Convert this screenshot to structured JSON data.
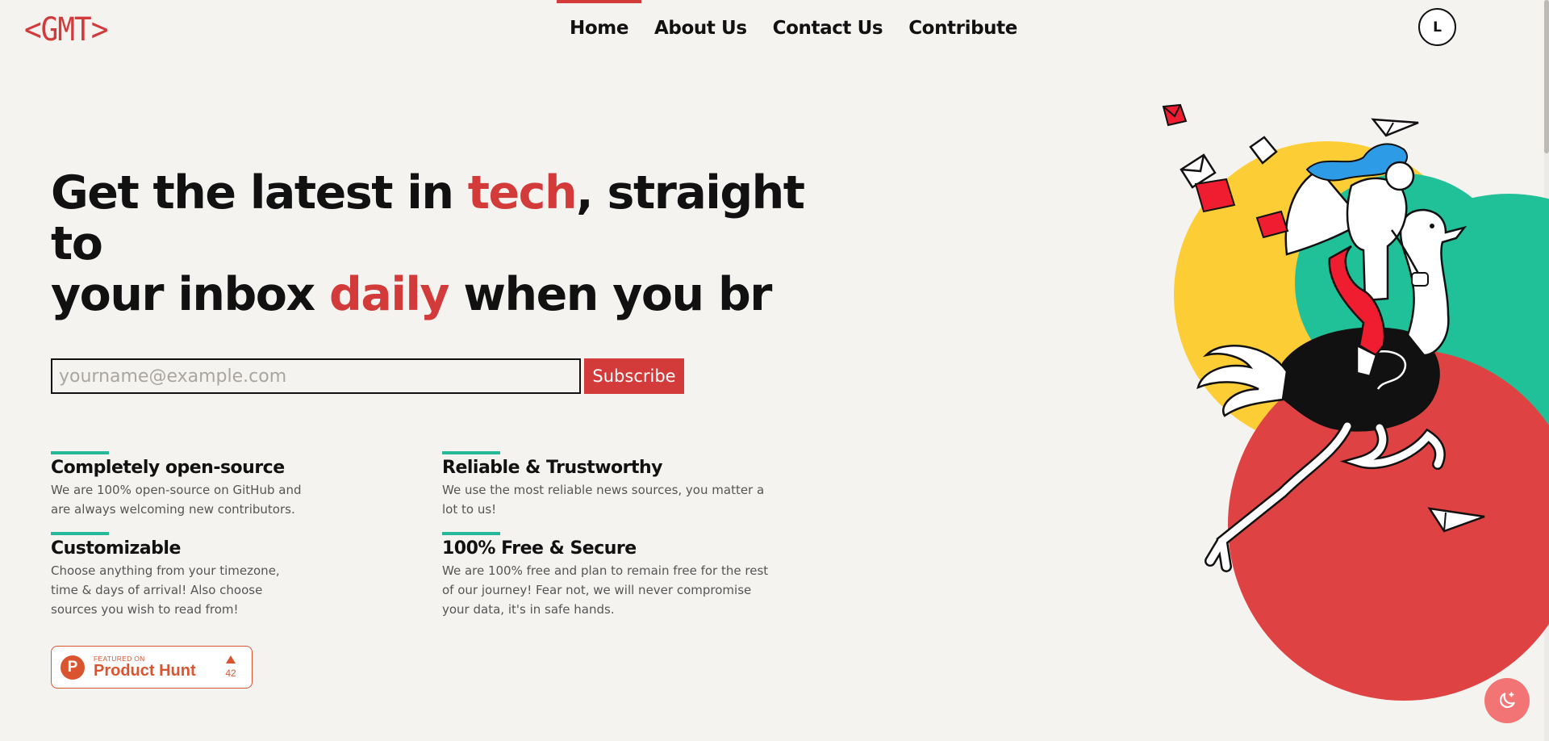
{
  "header": {
    "logo": "<GMT>",
    "nav": [
      {
        "label": "Home",
        "active": true
      },
      {
        "label": "About Us",
        "active": false
      },
      {
        "label": "Contact Us",
        "active": false
      },
      {
        "label": "Contribute",
        "active": false
      }
    ],
    "avatar_initial": "L"
  },
  "hero": {
    "title_part1": "Get the latest in ",
    "title_accent1": "tech",
    "title_part2": ", straight to",
    "title_part3": "your inbox ",
    "title_accent2": "daily",
    "title_part4": " when you br"
  },
  "subscribe": {
    "placeholder": "yourname@example.com",
    "value": "",
    "button_label": "Subscribe"
  },
  "features": [
    {
      "title": "Completely open-source",
      "line1": "We are 100% open-source on GitHub and",
      "line2": "are always welcoming new contributors.",
      "line3": ""
    },
    {
      "title": "Reliable & Trustworthy",
      "line1": "We use the most reliable news sources, you matter a",
      "line2": "lot to us!",
      "line3": ""
    },
    {
      "title": "Customizable",
      "line1": "Choose anything from your timezone,",
      "line2": "time & days of arrival! Also choose",
      "line3": "sources you wish to read from!"
    },
    {
      "title": "100% Free & Secure",
      "line1": "We are 100% free and plan to remain free for the rest",
      "line2": "of our journey! Fear not, we will never compromise",
      "line3": "your data, it's in safe hands."
    }
  ],
  "product_hunt": {
    "featured_label": "FEATURED ON",
    "name": "Product Hunt",
    "logo_letter": "P",
    "upvotes": "42"
  },
  "icons": {
    "dark_mode": "moon-star-icon",
    "illustration": "ostrich-rider-illustration"
  },
  "colors": {
    "accent": "#d33a3a",
    "feature_bar": "#25b99a",
    "background": "#f5f3f0",
    "product_hunt": "#da552f",
    "fab": "#f27474",
    "circle_yellow": "#fdcd36",
    "circle_green": "#20c198",
    "circle_red": "#df4242"
  }
}
